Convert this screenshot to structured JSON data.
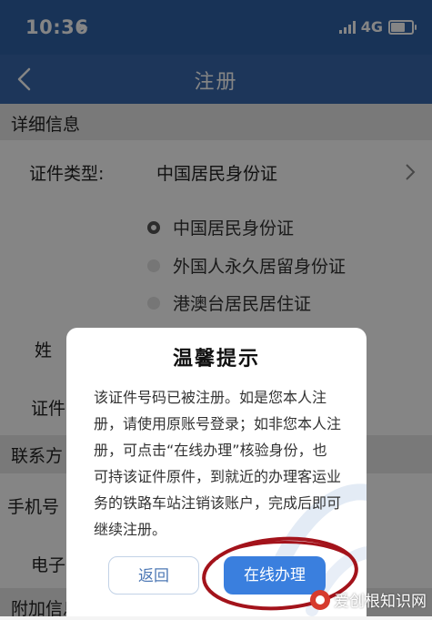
{
  "status": {
    "time": "10:36",
    "network": "4G",
    "battery_level": 0.75
  },
  "nav": {
    "title": "注册"
  },
  "sections": {
    "detail": "详细信息",
    "contact": "联系方",
    "extra": "附加信息"
  },
  "fields": {
    "id_type_label": "证件类型:",
    "id_type_value": "中国居民身份证",
    "surname_label": "姓",
    "id_number_label": "证件",
    "phone_label": "手机号",
    "email_label": "电子"
  },
  "id_options": [
    {
      "label": "中国居民身份证",
      "selected": true
    },
    {
      "label": "外国人永久居留身份证",
      "selected": false
    },
    {
      "label": "港澳台居民居住证",
      "selected": false
    }
  ],
  "dialog": {
    "title": "温馨提示",
    "message": "该证件号码已被注册。如是您本人注册，请使用原账号登录；如非您本人注册，可点击“在线办理”核验身份，也可持该证件原件，到就近的办理客运业务的铁路车站注销该账户，完成后即可继续注册。",
    "return_label": "返回",
    "online_label": "在线办理"
  },
  "watermark": {
    "text": "爱创根知识网"
  },
  "colors": {
    "nav": "#3868ad",
    "primary_button": "#3a7fde",
    "annotation": "#a3131b"
  }
}
